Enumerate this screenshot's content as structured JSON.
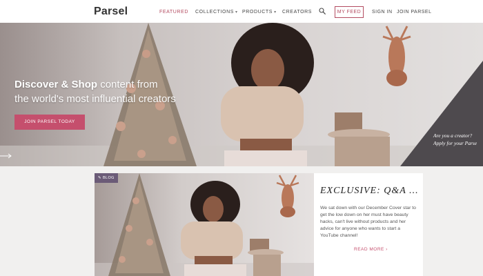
{
  "brand": {
    "logo": "Parsel"
  },
  "nav": {
    "items": [
      {
        "label": "FEATURED",
        "active": true
      },
      {
        "label": "COLLECTIONS",
        "dropdown": true
      },
      {
        "label": "PRODUCTS",
        "dropdown": true
      },
      {
        "label": "CREATORS"
      }
    ],
    "search_icon": "search-icon",
    "my_feed": "MY FEED",
    "sign_in": "SIGN IN",
    "join": "JOIN PARSEL"
  },
  "hero": {
    "title_bold": "Discover & Shop",
    "title_rest": " content from",
    "title_line2": "the world's most influential creators",
    "cta": "JOIN PARSEL TODAY",
    "creator_line1": "Are you a creator?",
    "creator_line2": "Apply for your Parse",
    "arrow_icon": "arrow-right-icon"
  },
  "card": {
    "badge_icon": "pencil-icon",
    "badge": "BLOG",
    "title": "EXCLUSIVE: Q&A ...",
    "text": "We sat down with our December Cover star to get the low down on her must have beauty hacks, can't live without products and her advice for anyone who wants to start a YouTube channel!",
    "read_more": "READ MORE ›"
  },
  "colors": {
    "accent": "#c54f6d",
    "header_bg": "#ffffff",
    "badge_bg": "#6b5b77",
    "page_bg": "#f1f0ef"
  }
}
